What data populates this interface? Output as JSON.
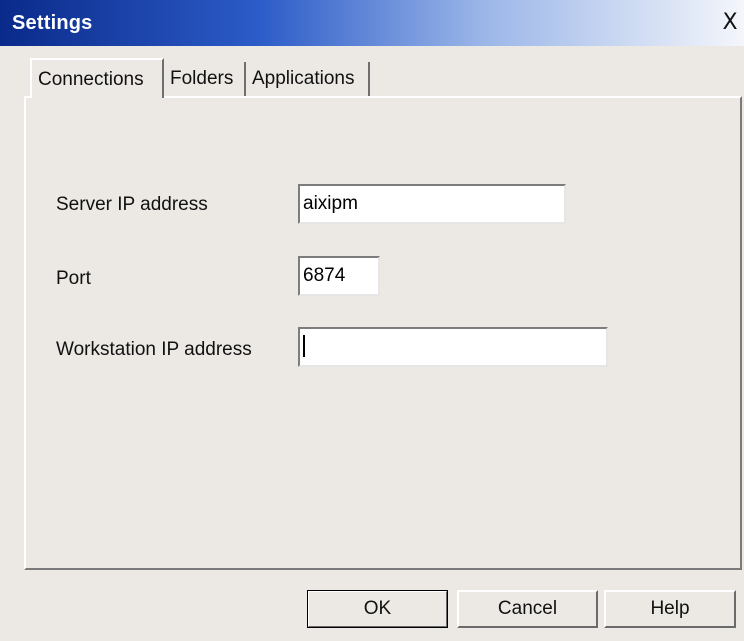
{
  "window": {
    "title": "Settings",
    "close_label": "X"
  },
  "tabs": [
    {
      "label": "Connections",
      "active": true
    },
    {
      "label": "Folders",
      "active": false
    },
    {
      "label": "Applications",
      "active": false
    }
  ],
  "form": {
    "server_ip": {
      "label": "Server IP address",
      "value": "aixipm"
    },
    "port": {
      "label": "Port",
      "value": "6874"
    },
    "workstation_ip": {
      "label": "Workstation IP address",
      "value": ""
    }
  },
  "buttons": {
    "ok": "OK",
    "cancel": "Cancel",
    "help": "Help"
  }
}
